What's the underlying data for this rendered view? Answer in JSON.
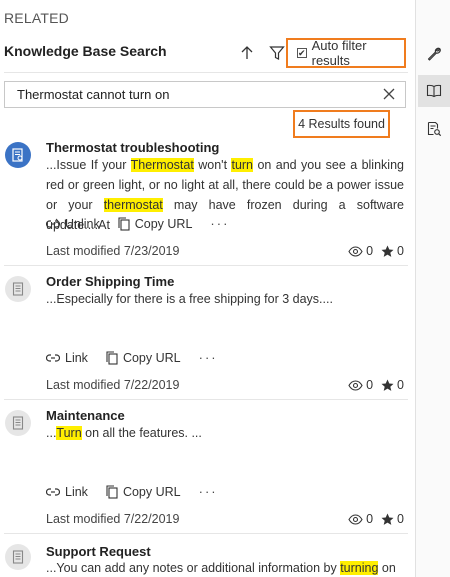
{
  "header": {
    "related_label": "RELATED",
    "title": "Knowledge Base Search"
  },
  "auto_filter": {
    "label": "Auto filter results",
    "checked": true
  },
  "search": {
    "value": "Thermostat cannot turn on"
  },
  "results": {
    "count_label": "4 Results found"
  },
  "articles": [
    {
      "title": "Thermostat troubleshooting",
      "excerpt_segments": [
        {
          "t": "...Issue If your ",
          "h": false
        },
        {
          "t": "Thermostat",
          "h": true
        },
        {
          "t": " won't ",
          "h": false
        },
        {
          "t": "turn",
          "h": true
        },
        {
          "t": " on and you see a blinking red or green light, or no light at all, there could be a power issue or your ",
          "h": false
        },
        {
          "t": "thermostat",
          "h": true
        },
        {
          "t": " may have frozen during a software update....At",
          "h": false
        }
      ],
      "link_label": "Unlink",
      "copy_label": "Copy URL",
      "more": "···",
      "modified": "Last modified 7/23/2019",
      "views": "0",
      "rating": "0",
      "linked": true
    },
    {
      "title": "Order Shipping Time",
      "excerpt_segments": [
        {
          "t": "...Especially for there is a free shipping for 3 days....",
          "h": false
        }
      ],
      "link_label": "Link",
      "copy_label": "Copy URL",
      "more": "···",
      "modified": "Last modified 7/22/2019",
      "views": "0",
      "rating": "0",
      "linked": false
    },
    {
      "title": "Maintenance",
      "excerpt_segments": [
        {
          "t": "...",
          "h": false
        },
        {
          "t": "Turn",
          "h": true
        },
        {
          "t": " on all the features. ...",
          "h": false
        }
      ],
      "link_label": "Link",
      "copy_label": "Copy URL",
      "more": "···",
      "modified": "Last modified 7/22/2019",
      "views": "0",
      "rating": "0",
      "linked": false
    },
    {
      "title": "Support Request",
      "excerpt_segments": [
        {
          "t": "...You can add any notes or additional information by ",
          "h": false
        },
        {
          "t": "turning",
          "h": true
        },
        {
          "t": " on",
          "h": false
        }
      ],
      "linked": false
    }
  ],
  "rail": {
    "items": [
      {
        "icon": "wrench-icon",
        "selected": false
      },
      {
        "icon": "knowledge-book-icon",
        "selected": true
      },
      {
        "icon": "document-search-icon",
        "selected": false
      }
    ]
  },
  "colors": {
    "accent_outline": "#f07c1e",
    "highlight": "#ffef00",
    "avatar_active": "#3b73c5"
  }
}
